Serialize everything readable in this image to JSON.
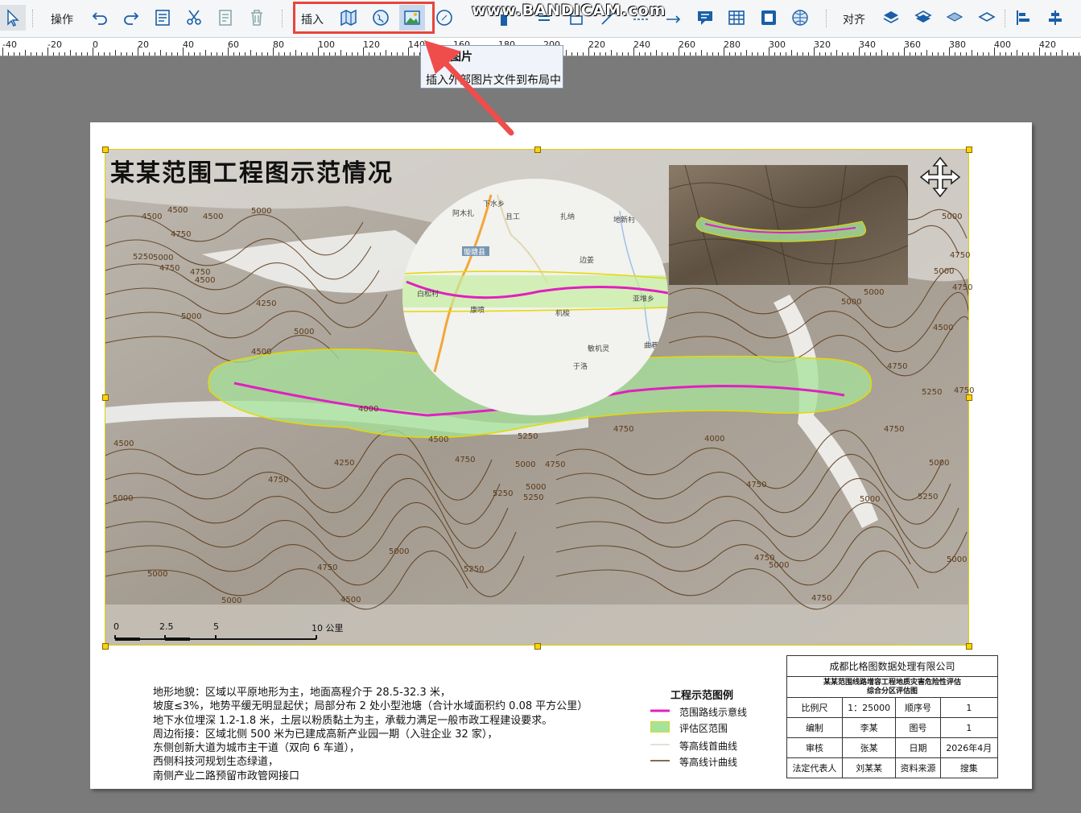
{
  "toolbar": {
    "operate_label": "操作",
    "insert_label": "插入",
    "align_label": "对齐",
    "icons": [
      "select-arrow-icon",
      "undo-icon",
      "redo-icon",
      "properties-icon",
      "cut-icon",
      "copy-icon",
      "delete-icon",
      "insert-map-icon",
      "insert-globe-icon",
      "insert-picture-icon",
      "compass-icon",
      "text-box-icon",
      "table-icon",
      "frame-icon",
      "globe-grid-icon",
      "layer-up-icon",
      "layer-down-icon",
      "layer-top-icon",
      "layer-bottom-icon",
      "align-left-icon",
      "align-center-icon"
    ]
  },
  "watermark": "www.BANDICAM.com",
  "ruler": {
    "labels": [
      "-40",
      "-20",
      "0",
      "20",
      "40",
      "60",
      "80",
      "100",
      "120",
      "140",
      "160",
      "180",
      "200",
      "220",
      "240",
      "260",
      "280",
      "300",
      "320",
      "340",
      "360",
      "380",
      "400",
      "420"
    ]
  },
  "tooltip": {
    "title": "图片",
    "description": "插入外部图片文件到布局中"
  },
  "colors": {
    "highlight": "#e8453c",
    "route": "#e020c0",
    "assessment_area": "#a6e39a",
    "contour_index": "#5a3a1a"
  },
  "map": {
    "title": "某某范围工程图示范情况",
    "contour_labels": [
      "4500",
      "4500",
      "5000",
      "4500",
      "5250",
      "5000",
      "4750",
      "4750",
      "4750",
      "5000",
      "4500",
      "4250",
      "5000",
      "4000",
      "4500",
      "5250",
      "4750",
      "4500",
      "4500",
      "4750",
      "5000",
      "4750",
      "5250",
      "5000",
      "5250",
      "4250",
      "4750",
      "5000",
      "5000",
      "4000",
      "4750",
      "5250",
      "5000",
      "4750",
      "4750",
      "4500",
      "5000",
      "5000",
      "4750",
      "4750",
      "5250",
      "5000",
      "4750",
      "5000",
      "5000",
      "4750",
      "5000",
      "4750",
      "4500",
      "5000",
      "5250",
      "4750",
      "5000",
      "5000"
    ],
    "circle_places": [
      "下水乡",
      "阿木扎",
      "且工",
      "扎纳",
      "地新村",
      "璇瑭县",
      "边姜",
      "白松村",
      "康喷",
      "亚堆乡",
      "机梭",
      "敏机灵",
      "曲巷",
      "于洛"
    ],
    "scalebar": {
      "ticks": [
        "0",
        "2.5",
        "5",
        "10 公里"
      ]
    }
  },
  "notes": [
    "地形地貌：区域以平原地形为主，地面高程介于 28.5-32.3 米，",
    "坡度≤3%，地势平缓无明显起伏；局部分布 2 处小型池塘（合计水域面积约 0.08 平方公里）",
    "地下水位埋深 1.2-1.8 米，土层以粉质黏土为主，承载力满足一般市政工程建设要求。",
    "周边衔接：区域北侧 500 米为已建成高新产业园一期（入驻企业 32 家），",
    "东侧创新大道为城市主干道（双向 6 车道），",
    "西侧科技河规划生态绿道，",
    "南侧产业二路预留市政管网接口"
  ],
  "legend": {
    "title": "工程示范图例",
    "items": [
      "范围路线示意线",
      "评估区范围",
      "等高线首曲线",
      "等高线计曲线"
    ]
  },
  "title_block": {
    "company": "成都比格图数据处理有限公司",
    "project": "某某范围线路增容工程地质灾害危险性评估",
    "subtitle": "综合分区评估图",
    "rows": [
      [
        "比例尺",
        "1：25000",
        "顺序号",
        "1"
      ],
      [
        "编制",
        "李某",
        "图号",
        "1"
      ],
      [
        "审核",
        "张某",
        "日期",
        "2026年4月"
      ],
      [
        "法定代表人",
        "刘某某",
        "资料来源",
        "搜集"
      ]
    ]
  }
}
